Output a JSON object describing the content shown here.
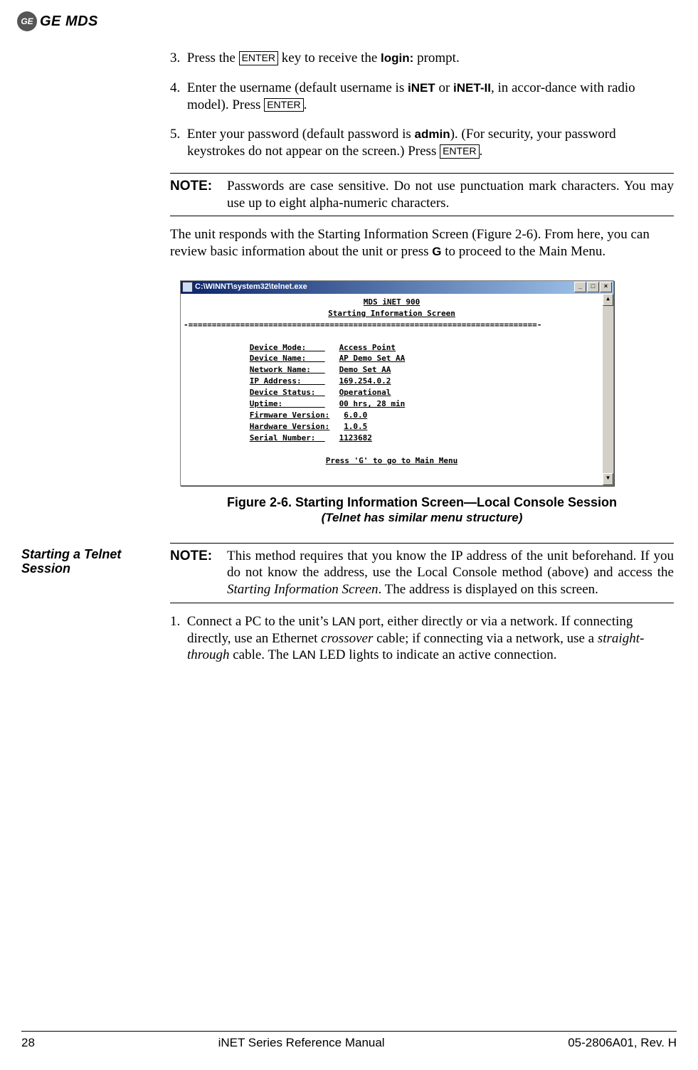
{
  "header": {
    "brand_badge": "GE",
    "brand_text": "GE MDS"
  },
  "steps_a": [
    {
      "n": "3.",
      "pre": "Press the ",
      "key": "ENTER",
      "post": " key to receive the ",
      "strong": "login:",
      "tail": " prompt."
    },
    {
      "n": "4.",
      "text1": "Enter the username (default username is ",
      "s1": "iNET",
      "mid": " or ",
      "s2": "iNET-II",
      "text2": ", in accor-dance with radio model). Press ",
      "key": "ENTER",
      "dot": "."
    },
    {
      "n": "5.",
      "text1": "Enter your password (default password is ",
      "s1": "admin",
      "text2": "). (For security, your password keystrokes do not appear on the screen.) Press ",
      "key": "ENTER",
      "dot": "."
    }
  ],
  "note1": {
    "label": "NOTE:",
    "body": "Passwords are case sensitive. Do not use punctuation mark characters. You may use up to eight alpha-numeric characters."
  },
  "para1": {
    "a": "The unit responds with the Starting Information Screen (Figure 2-6). From here, you can review basic information about the unit or press ",
    "g": "G",
    "b": " to proceed to the Main Menu."
  },
  "telnet": {
    "title": "C:\\WINNT\\system32\\telnet.exe",
    "btn_min": "_",
    "btn_max": "□",
    "btn_close": "×",
    "scroll_up": "▲",
    "scroll_dn": "▼",
    "line_top": "MDS iNET 900",
    "line_sub": "Starting Information Screen",
    "rule": "-==========================================================================-",
    "rows": [
      {
        "label": "Device Mode:",
        "value": "Access Point"
      },
      {
        "label": "Device Name:",
        "value": "AP Demo Set AA"
      },
      {
        "label": "Network Name:",
        "value": "Demo Set AA"
      },
      {
        "label": "IP Address:",
        "value": "169.254.0.2"
      },
      {
        "label": "Device Status:",
        "value": "Operational"
      },
      {
        "label": "Uptime:",
        "value": "00 hrs, 28 min"
      },
      {
        "label": "Firmware Version:",
        "value": "6.0.0"
      },
      {
        "label": "Hardware Version:",
        "value": "1.0.5"
      },
      {
        "label": "Serial Number:",
        "value": "1123682"
      }
    ],
    "footer": "Press 'G' to go to Main Menu"
  },
  "caption": {
    "main": "Figure 2-6. Starting Information Screen—Local Console Session",
    "sub": "(Telnet has similar menu structure)"
  },
  "sidebar": {
    "telnet_heading": "Starting a Telnet Session"
  },
  "note2": {
    "label": "NOTE:",
    "a": "This method requires that you know the IP address of the unit beforehand. If you do not know the address, use the Local Console method (above) and access the ",
    "i": "Starting Information Screen",
    "b": ". The address is displayed on this screen."
  },
  "steps_b": [
    {
      "n": "1.",
      "a": "Connect a PC to the unit’s ",
      "lan1": "LAN",
      "b": " port, either directly or via a network. If connecting directly, use an Ethernet ",
      "i1": "crossover",
      "c": " cable; if connecting via a network, use a ",
      "i2": "straight-through",
      "d": " cable. The ",
      "lan2": "LAN",
      "e": " LED lights to indicate an active connection."
    }
  ],
  "footer": {
    "page": "28",
    "title": "iNET Series Reference Manual",
    "docnum": "05-2806A01, Rev. H"
  }
}
